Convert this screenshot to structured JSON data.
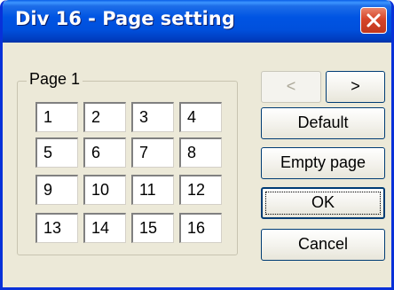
{
  "window": {
    "title": "Div 16 - Page setting"
  },
  "group": {
    "label": "Page 1",
    "cells": [
      "1",
      "2",
      "3",
      "4",
      "5",
      "6",
      "7",
      "8",
      "9",
      "10",
      "11",
      "12",
      "13",
      "14",
      "15",
      "16"
    ]
  },
  "buttons": {
    "prev_label": "<",
    "next_label": ">",
    "default_label": "Default",
    "empty_page_label": "Empty page",
    "ok_label": "OK",
    "cancel_label": "Cancel"
  },
  "colors": {
    "title_bar": "#0054e3",
    "window_bg": "#ece9d8",
    "close_button": "#d6452a"
  },
  "icons": {
    "close": "close-icon"
  }
}
